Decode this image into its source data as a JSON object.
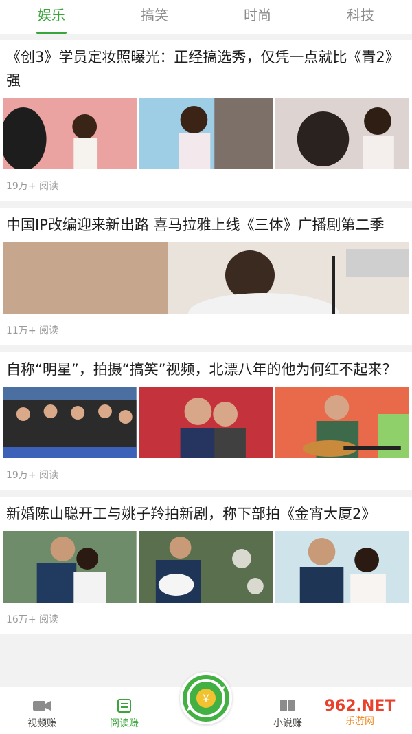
{
  "tabs": [
    "娱乐",
    "搞笑",
    "时尚",
    "科技"
  ],
  "articles": [
    {
      "title": "《创3》学员定妆照曝光：正经搞选秀，仅凭一点就比《青2》强",
      "reads": "19万+ 阅读"
    },
    {
      "title": "中国IP改编迎来新出路 喜马拉雅上线《三体》广播剧第二季",
      "reads": "11万+ 阅读"
    },
    {
      "title": "自称“明星”，拍摄“搞笑”视频，北漂八年的他为何红不起来？",
      "reads": "19万+ 阅读"
    },
    {
      "title": "新婚陈山聪开工与姚子羚拍新剧，称下部拍《金宵大厦2》",
      "reads": "16万+ 阅读"
    }
  ],
  "bottom_nav": {
    "video": "视频赚",
    "read": "阅读赚",
    "novel": "小说赚"
  },
  "watermark": {
    "logo": "962.NET",
    "caption": "乐游网"
  },
  "colors": {
    "accent": "#3aa53a",
    "text": "#1e1e1e",
    "muted": "#9a9a9a"
  }
}
